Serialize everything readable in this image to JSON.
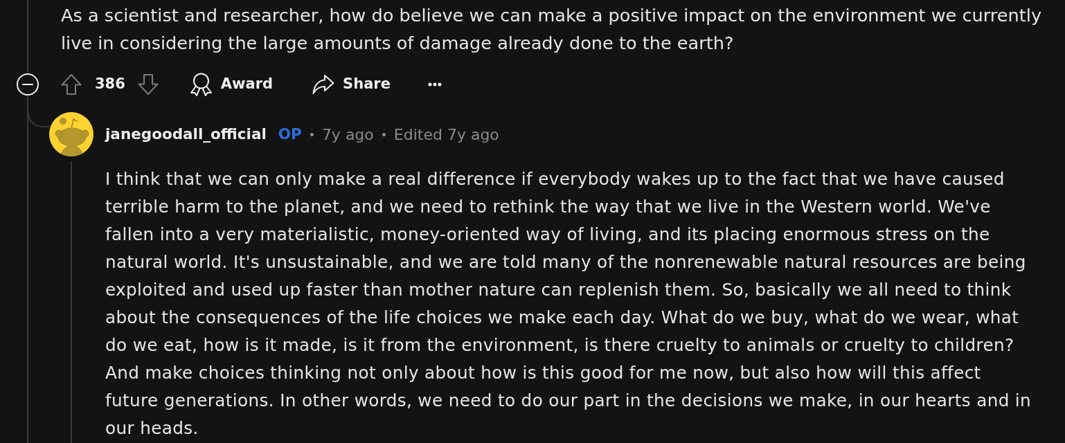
{
  "post": {
    "text": "As a scientist and researcher, how do believe we can make a positive impact on the environment we currently live in considering the large amounts of damage already done to the earth?"
  },
  "actions": {
    "expanded": true,
    "votes": "386",
    "award": "Award",
    "share": "Share"
  },
  "comment": {
    "author": "janegoodall_official",
    "op_badge": "OP",
    "time": "7y ago",
    "edited": "Edited 7y ago",
    "body": "I think that we can only make a real difference if everybody wakes up to the fact that we have caused terrible harm to the planet, and we need to rethink the way that we live in the Western world. We've fallen into a very materialistic, money-oriented way of living, and its placing enormous stress on the natural world. It's unsustainable, and we are told many of the nonrenewable natural resources are being exploited and used up faster than mother nature can replenish them. So, basically we all need to think about the consequences of the life choices we make each day. What do we buy, what do we wear, what do we eat, how is it made, is it from the environment, is there cruelty to animals or cruelty to children? And make choices thinking not only about how is this good for me now, but also how will this affect future generations. In other words, we need to do our part in the decisions we make, in our hearts and in our heads."
  }
}
